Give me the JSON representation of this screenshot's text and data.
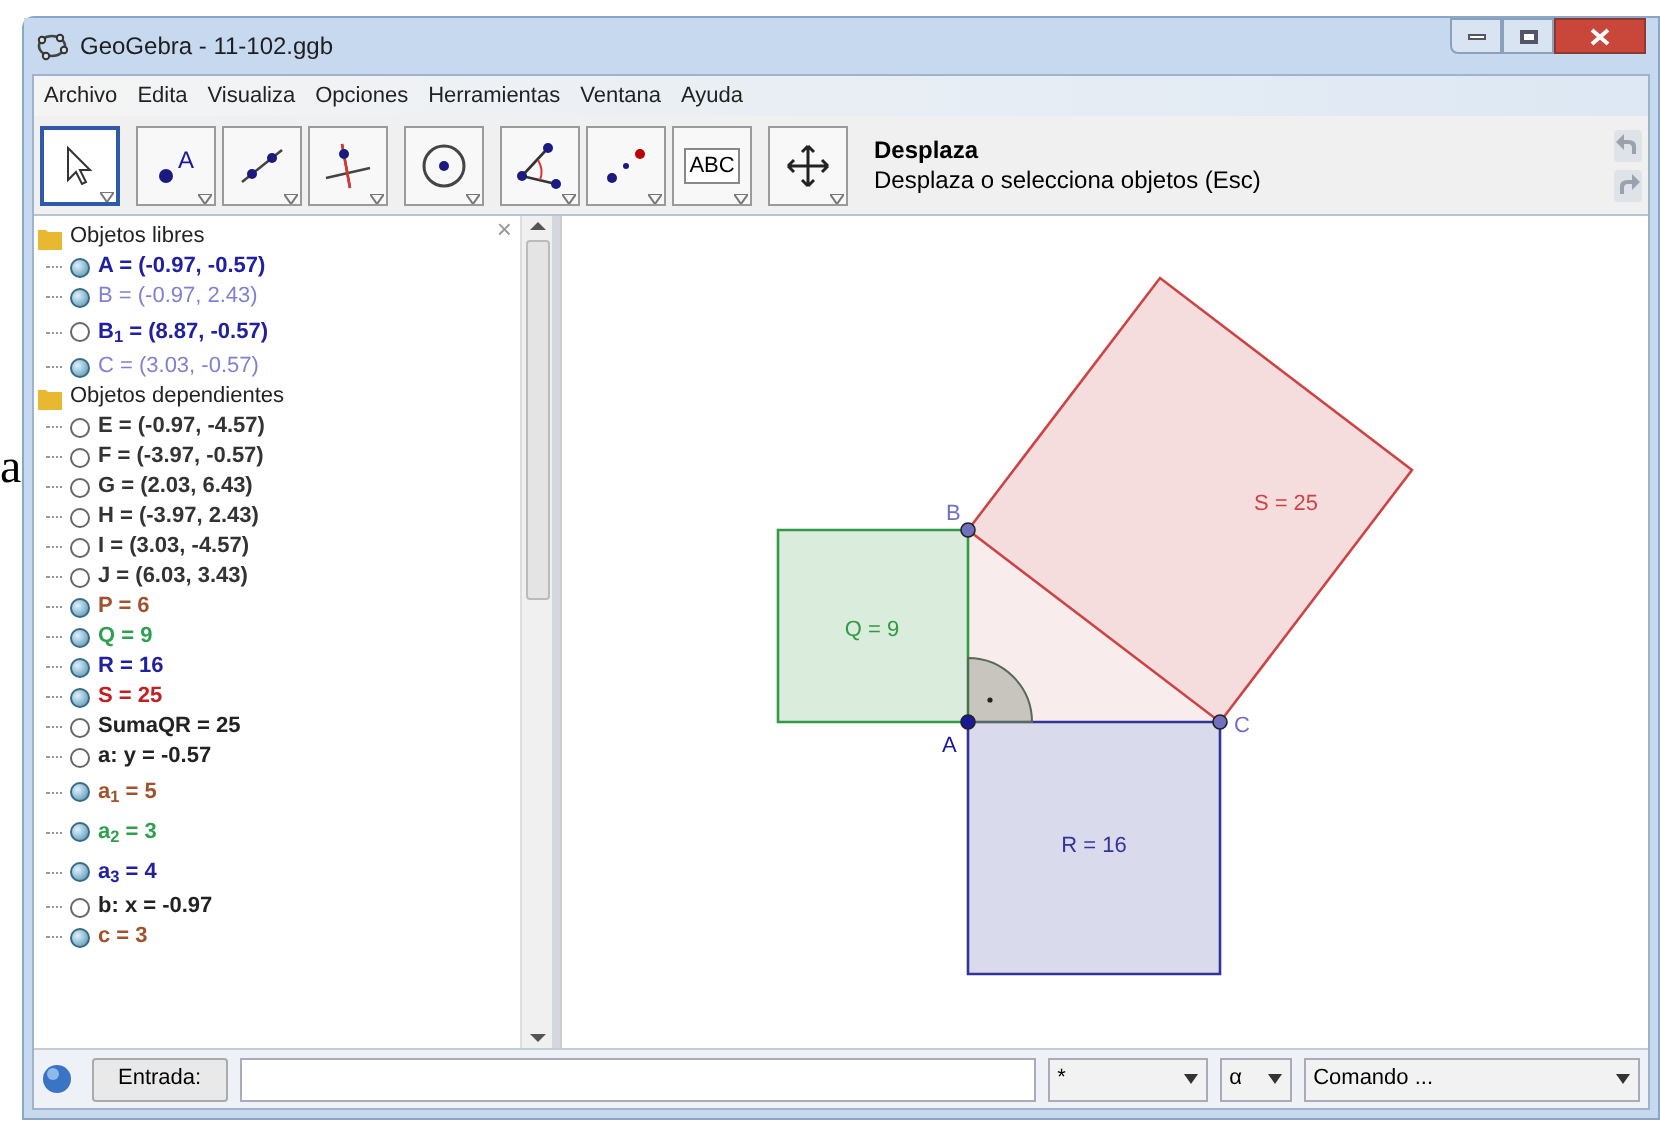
{
  "stray_text": "a",
  "window": {
    "title": "GeoGebra - 11-102.ggb"
  },
  "menu": [
    "Archivo",
    "Edita",
    "Visualiza",
    "Opciones",
    "Herramientas",
    "Ventana",
    "Ayuda"
  ],
  "toolbar": {
    "tools": [
      {
        "kind": "move",
        "selected": true
      },
      {
        "kind": "point",
        "text": "A",
        "selected": false
      },
      {
        "kind": "line",
        "selected": false
      },
      {
        "kind": "perpendicular",
        "selected": false
      },
      {
        "kind": "circle",
        "selected": false
      },
      {
        "kind": "angle",
        "selected": false
      },
      {
        "kind": "reflect",
        "selected": false
      },
      {
        "kind": "text",
        "text": "ABC",
        "selected": false
      },
      {
        "kind": "pan",
        "selected": false
      }
    ],
    "tool_name": "Desplaza",
    "tool_help": "Desplaza o selecciona objetos (Esc)"
  },
  "algebra": {
    "close": "×",
    "groups": [
      {
        "label": "Objetos libres",
        "items": [
          {
            "text": "A = (-0.97, -0.57)",
            "shown": true,
            "color": "#2020a0",
            "bold": true
          },
          {
            "text": "B = (-0.97, 2.43)",
            "shown": true,
            "color": "#8080d0",
            "bold": false
          },
          {
            "text": "B$_{1}$ = (8.87, -0.57)",
            "shown": false,
            "color": "#2020a0",
            "bold": true
          },
          {
            "text": "C = (3.03, -0.57)",
            "shown": true,
            "color": "#8080d0",
            "bold": false
          }
        ]
      },
      {
        "label": "Objetos dependientes",
        "items": [
          {
            "text": "E = (-0.97, -4.57)",
            "shown": false,
            "color": "#333333",
            "bold": true
          },
          {
            "text": "F = (-3.97, -0.57)",
            "shown": false,
            "color": "#333333",
            "bold": true
          },
          {
            "text": "G = (2.03, 6.43)",
            "shown": false,
            "color": "#333333",
            "bold": true
          },
          {
            "text": "H = (-3.97, 2.43)",
            "shown": false,
            "color": "#333333",
            "bold": true
          },
          {
            "text": "I = (3.03, -4.57)",
            "shown": false,
            "color": "#333333",
            "bold": true
          },
          {
            "text": "J = (6.03, 3.43)",
            "shown": false,
            "color": "#333333",
            "bold": true
          },
          {
            "text": "P = 6",
            "shown": true,
            "color": "#a0522d",
            "bold": true
          },
          {
            "text": "Q = 9",
            "shown": true,
            "color": "#30a050",
            "bold": true
          },
          {
            "text": "R = 16",
            "shown": true,
            "color": "#2020a0",
            "bold": true
          },
          {
            "text": "S = 25",
            "shown": true,
            "color": "#c02020",
            "bold": true
          },
          {
            "text": "SumaQR = 25",
            "shown": false,
            "color": "#222222",
            "bold": true
          },
          {
            "text": "a: y = -0.57",
            "shown": false,
            "color": "#222222",
            "bold": true
          },
          {
            "text": "a$_{1}$ = 5",
            "shown": true,
            "color": "#a0522d",
            "bold": true
          },
          {
            "text": "a$_{2}$ = 3",
            "shown": true,
            "color": "#30a050",
            "bold": true
          },
          {
            "text": "a$_{3}$ = 4",
            "shown": true,
            "color": "#2020a0",
            "bold": true
          },
          {
            "text": "b: x = -0.97",
            "shown": false,
            "color": "#222222",
            "bold": true
          },
          {
            "text": "c = 3",
            "shown": true,
            "color": "#a0522d",
            "bold": true
          }
        ]
      }
    ]
  },
  "graphics": {
    "shapes": [
      {
        "kind": "triangle",
        "color": "#cc6666"
      },
      {
        "kind": "square",
        "label": "Q = 9",
        "color": "#339944"
      },
      {
        "kind": "square",
        "label": "R = 16",
        "color": "#333399"
      },
      {
        "kind": "square",
        "label": "S = 25",
        "color": "#cc4444"
      },
      {
        "kind": "angle",
        "color": "#556b55"
      }
    ],
    "points": [
      {
        "label": "A",
        "color": "#1a1a99"
      },
      {
        "label": "B",
        "color": "#7070c0"
      },
      {
        "label": "C",
        "color": "#7070c0"
      }
    ]
  },
  "input_bar": {
    "label": "Entrada:",
    "symbol": "*",
    "greek": "α",
    "command": "Comando ..."
  }
}
